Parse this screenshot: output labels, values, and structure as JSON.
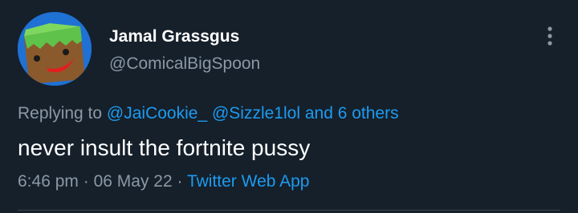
{
  "author": {
    "name": "Jamal Grassgus",
    "handle": "@ComicalBigSpoon",
    "avatar_icon": "grass-block-face-icon"
  },
  "more_icon": "more-vertical-icon",
  "reply": {
    "prefix": "Replying to",
    "mention_1": "@JaiCookie_",
    "mention_2": "@Sizzle1lol",
    "others": "and 6 others"
  },
  "tweet": {
    "text": "never insult the fortnite pussy"
  },
  "meta": {
    "time": "6:46 pm",
    "separator_1": "·",
    "date": "06 May 22",
    "separator_2": "·",
    "source": "Twitter Web App"
  },
  "colors": {
    "background": "#15202b",
    "primary_text": "#ffffff",
    "secondary_text": "#8b98a5",
    "link": "#1d9bf0",
    "avatar_bg": "#1f71d4"
  }
}
